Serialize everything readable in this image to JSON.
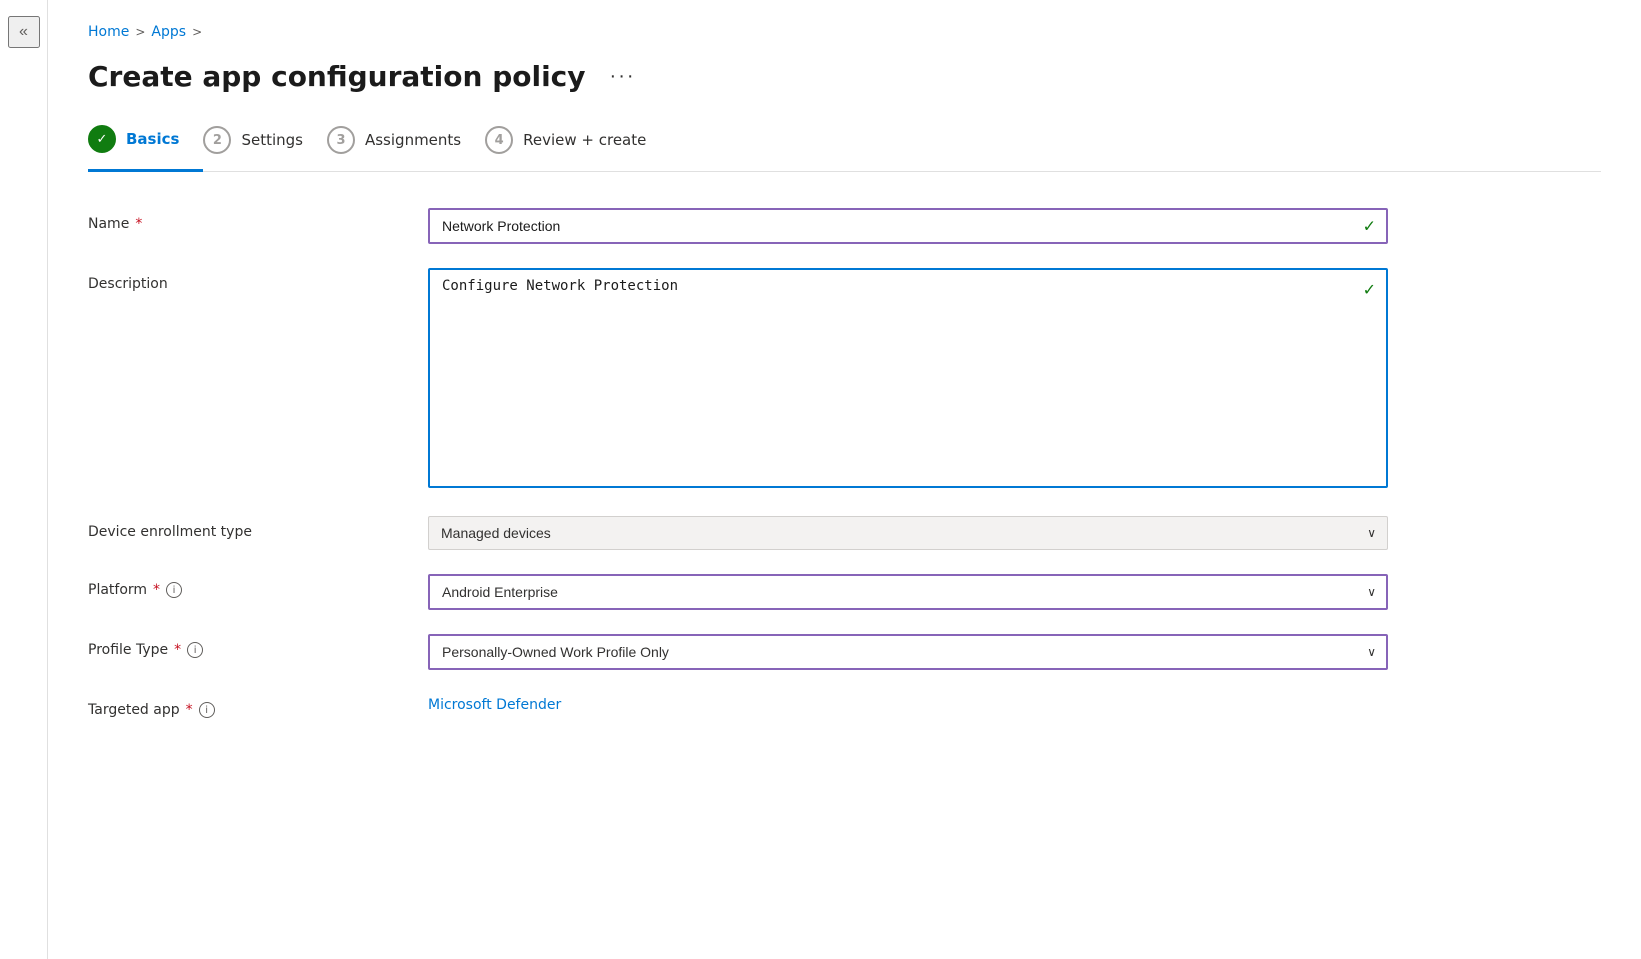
{
  "sidebar": {
    "collapse_icon": "«"
  },
  "breadcrumb": {
    "home_label": "Home",
    "separator1": ">",
    "apps_label": "Apps",
    "separator2": ">"
  },
  "page": {
    "title": "Create app configuration policy",
    "more_label": "···"
  },
  "wizard": {
    "steps": [
      {
        "id": "basics",
        "label": "Basics",
        "number": "✓",
        "state": "done",
        "active": true
      },
      {
        "id": "settings",
        "label": "Settings",
        "number": "2",
        "state": "inactive",
        "active": false
      },
      {
        "id": "assignments",
        "label": "Assignments",
        "number": "3",
        "state": "inactive",
        "active": false
      },
      {
        "id": "review",
        "label": "Review + create",
        "number": "4",
        "state": "inactive",
        "active": false
      }
    ]
  },
  "form": {
    "name_label": "Name",
    "name_value": "Network Protection",
    "name_check": "✓",
    "description_label": "Description",
    "description_value": "Configure Network Protection",
    "description_check": "✓",
    "device_enrollment_label": "Device enrollment type",
    "device_enrollment_value": "Managed devices",
    "platform_label": "Platform",
    "platform_value": "Android Enterprise",
    "profile_type_label": "Profile Type",
    "profile_type_value": "Personally-Owned Work Profile Only",
    "targeted_app_label": "Targeted app",
    "targeted_app_link": "Microsoft Defender",
    "required_star": "*",
    "info_icon_label": "i",
    "dropdown_arrow": "∨"
  }
}
